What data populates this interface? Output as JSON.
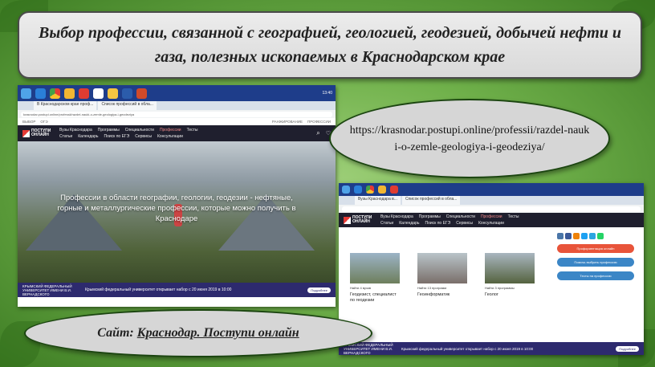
{
  "slide": {
    "title": "Выбор профессии, связанной с географией, геологией, геодезией, добычей нефти и газа, полезных ископаемых в Краснодарском крае",
    "url": "https://krasnodar.postupi.online/professii/razdel-nauki-o-zemle-geologiya-i-geodeziya/",
    "site_prefix": "Сайт: ",
    "site_link": "Краснодар. Поступи онлайн"
  },
  "screenshot1": {
    "tabs": [
      "В Краснодарском крае проф...",
      "Список профессий в обла..."
    ],
    "address": "krasnodar.postupi.online/professii/razdel-nauki-o-zemle-geologiya-i-geodeziya",
    "top_links": [
      "ВЫБОР",
      "ОГЭ",
      "РАНЖИРОВАНИЕ",
      "ПРОФЕССИИ"
    ],
    "logo": "ПОСТУПИ ОНЛАЙН",
    "nav": [
      "Вузы Краснодара",
      "Программы",
      "Специальности",
      "Профессии",
      "Тесты"
    ],
    "nav2": [
      "Статьи",
      "Календарь",
      "Поиск по ЕГЭ",
      "Сервисы",
      "Консультации"
    ],
    "hero_text": "Профессии в области географии, геологии, геодезии - нефтяные, горные и металлургические профессии, которые можно получить в Краснодаре",
    "banner_org": "КРЫМСКИЙ ФЕДЕРАЛЬНЫЙ УНИВЕРСИТЕТ ИМЕНИ В.И. ВЕРНАДСКОГО",
    "banner_text": "Крымский федеральный университет открывает набор с 20 июня 2019 в 10:00",
    "banner_btn": "Подробнее",
    "clock": "13:40"
  },
  "screenshot2": {
    "tabs": [
      "Вузы Краснодара в...",
      "Список профессий в обла..."
    ],
    "logo": "ПОСТУПИ ОНЛАЙН",
    "nav": [
      "Вузы Краснодара",
      "Программы",
      "Специальности",
      "Профессии",
      "Тесты"
    ],
    "nav2": [
      "Статьи",
      "Календарь",
      "Поиск по ЕГЭ",
      "Сервисы",
      "Консультации"
    ],
    "cards": [
      {
        "meta": "Найти  4 вузов",
        "title": "Геодезист, специалист по геодезии"
      },
      {
        "meta": "Найти  13 программ",
        "title": "Геоинформатик"
      },
      {
        "meta": "Найти  3 программы",
        "title": "Геолог"
      }
    ],
    "side_buttons": [
      "Профориентация онлайн",
      "Помочь выбрать профессию",
      "Тесты на профессию"
    ],
    "banner_org": "КРЫМСКИЙ ФЕДЕРАЛЬНЫЙ УНИВЕРСИТЕТ ИМЕНИ В.И. ВЕРНАДСКОГО",
    "banner_text": "Крымский федеральный университет открывает набор с 20 июня 2019 в 10:00",
    "banner_btn": "Подробнее"
  },
  "colors": {
    "title_bg": "#e2e2e2",
    "oval_bg": "#d6d6d6",
    "nav_bg": "#1f1f2e",
    "banner_bg": "#2d2a6e",
    "side_btn": "#3b86c6",
    "side_btn_red": "#e8543a"
  }
}
